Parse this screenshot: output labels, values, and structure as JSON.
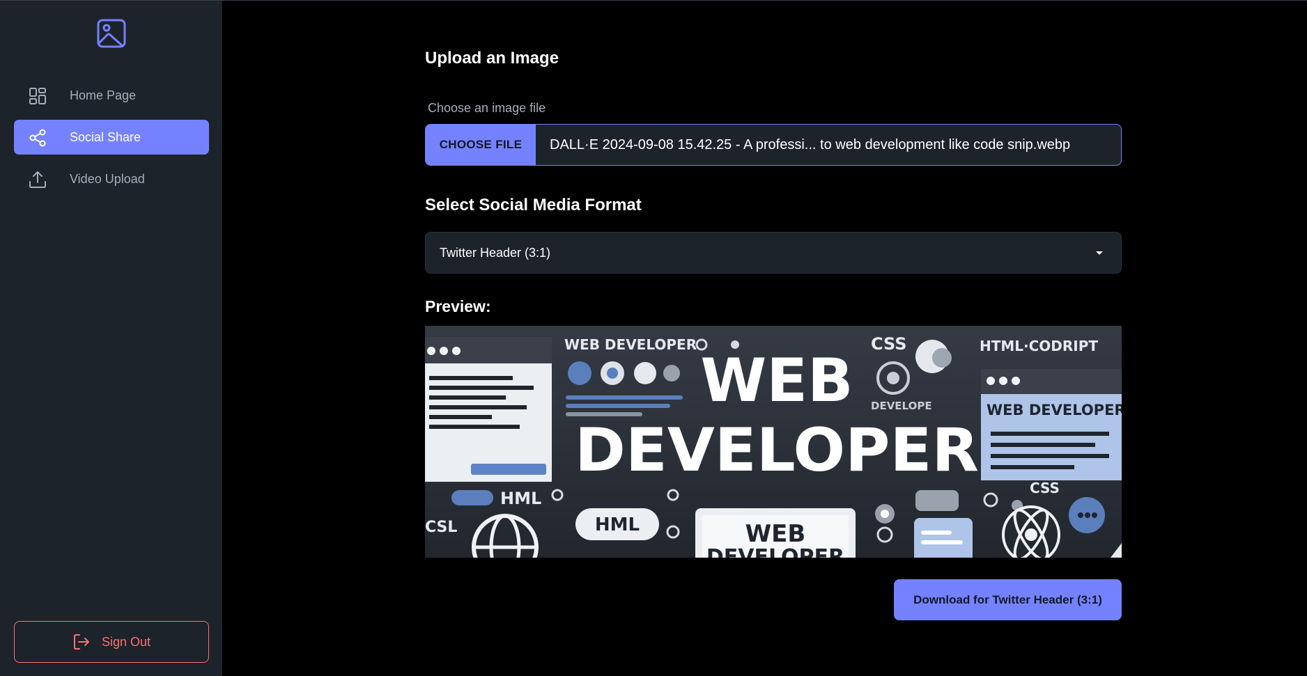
{
  "sidebar": {
    "items": [
      {
        "label": "Home Page",
        "icon": "layout-dashboard-icon"
      },
      {
        "label": "Social Share",
        "icon": "share-icon",
        "active": true
      },
      {
        "label": "Video Upload",
        "icon": "upload-icon"
      }
    ],
    "signout_label": "Sign Out"
  },
  "main": {
    "title": "Upload an Image",
    "file_label": "Choose an image file",
    "file_button": "CHOOSE FILE",
    "file_name": "DALL·E 2024-09-08 15.42.25 - A professi... to web development like code snip.webp",
    "format_title": "Select Social Media Format",
    "format_selected": "Twitter Header (3:1)",
    "preview_title": "Preview:",
    "preview_image": {
      "text_line1": "WEB",
      "text_line2": "DEVELOPER",
      "top_text": "WEB DEVELOPER",
      "top_css": "CSS",
      "top_right": "HTML·CODRIPT",
      "right_panel": "WEB DEVELOPER",
      "left_hml": "HML",
      "left_csl": "CSL",
      "pill_hml": "HML",
      "center_web": "WEB",
      "center_dev": "DEVELOPER",
      "right_css": "CSS",
      "develope": "DEVELOPE"
    },
    "download_label": "Download for Twitter Header (3:1)"
  },
  "colors": {
    "accent": "#7582ff",
    "sidebar_bg": "#1d232a",
    "danger": "#f87272",
    "page_bg": "#000000"
  }
}
